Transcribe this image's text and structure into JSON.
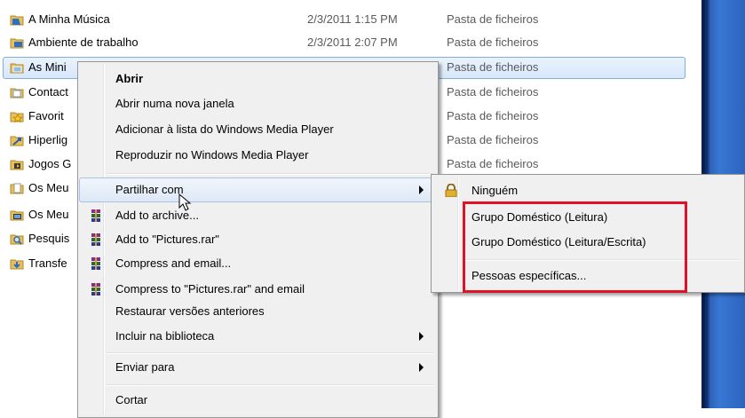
{
  "files": [
    {
      "name": "A Minha Música",
      "date": "2/3/2011 1:15 PM",
      "type": "Pasta de ficheiros",
      "icon": "music-folder-icon"
    },
    {
      "name": "Ambiente de trabalho",
      "date": "2/3/2011 2:07 PM",
      "type": "Pasta de ficheiros",
      "icon": "desktop-folder-icon"
    },
    {
      "name": "As Mini",
      "date": "",
      "type": "Pasta de ficheiros",
      "icon": "pictures-folder-icon"
    },
    {
      "name": "Contact",
      "date": "",
      "type": "Pasta de ficheiros",
      "icon": "contacts-folder-icon"
    },
    {
      "name": "Favorit",
      "date": "",
      "type": "Pasta de ficheiros",
      "icon": "favorites-folder-icon"
    },
    {
      "name": "Hiperlig",
      "date": "",
      "type": "Pasta de ficheiros",
      "icon": "links-folder-icon"
    },
    {
      "name": "Jogos G",
      "date": "",
      "type": "Pasta de ficheiros",
      "icon": "games-folder-icon"
    },
    {
      "name": "Os Meu",
      "date": "",
      "type": "",
      "icon": "documents-folder-icon"
    },
    {
      "name": "Os Meu",
      "date": "",
      "type": "",
      "icon": "videos-folder-icon"
    },
    {
      "name": "Pesquis",
      "date": "",
      "type": "",
      "icon": "searches-folder-icon"
    },
    {
      "name": "Transfe",
      "date": "",
      "type": "",
      "icon": "downloads-folder-icon"
    }
  ],
  "context_menu": {
    "items": [
      {
        "label": "Abrir"
      },
      {
        "label": "Abrir numa nova janela"
      },
      {
        "label": "Adicionar à lista do Windows Media Player"
      },
      {
        "label": "Reproduzir no Windows Media Player"
      },
      {
        "label": "Partilhar com"
      },
      {
        "label": "Add to archive..."
      },
      {
        "label": "Add to \"Pictures.rar\""
      },
      {
        "label": "Compress and email..."
      },
      {
        "label": "Compress to \"Pictures.rar\" and email"
      },
      {
        "label": "Restaurar versões anteriores"
      },
      {
        "label": "Incluir na biblioteca"
      },
      {
        "label": "Enviar para"
      },
      {
        "label": "Cortar"
      }
    ]
  },
  "share_submenu": {
    "items": [
      {
        "label": "Ninguém"
      },
      {
        "label": "Grupo Doméstico (Leitura)"
      },
      {
        "label": "Grupo Doméstico (Leitura/Escrita)"
      },
      {
        "label": "Pessoas específicas..."
      }
    ]
  },
  "colors": {
    "highlight_border": "#e0122a",
    "selection": "#84acdd"
  }
}
